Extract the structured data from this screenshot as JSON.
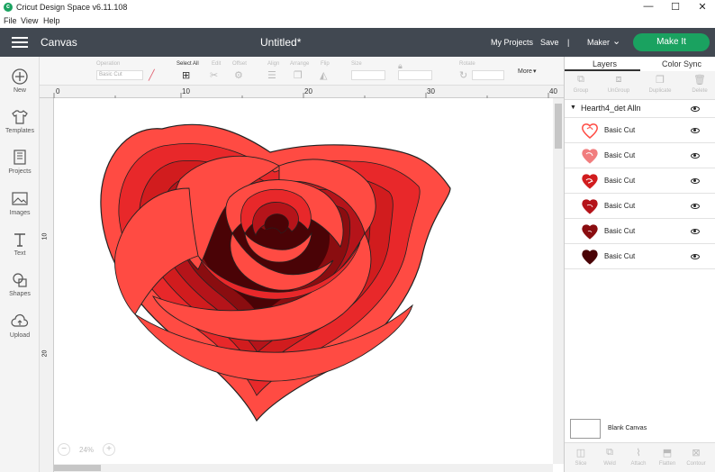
{
  "window": {
    "app_title": "Cricut Design Space  v6.11.108",
    "logo": "c",
    "controls": [
      "—",
      "☐",
      "✕"
    ]
  },
  "menu": [
    "File",
    "View",
    "Help"
  ],
  "header": {
    "section": "Canvas",
    "doc_title": "Untitled*",
    "my_projects": "My Projects",
    "save": "Save",
    "separator": "|",
    "machine": "Maker",
    "make_it": "Make It",
    "accent": "#1aa260",
    "bg": "#414851"
  },
  "sidebar": {
    "items": [
      {
        "label": "New",
        "icon": "plus-circle-icon"
      },
      {
        "label": "Templates",
        "icon": "shirt-icon"
      },
      {
        "label": "Projects",
        "icon": "projects-icon"
      },
      {
        "label": "Images",
        "icon": "image-icon"
      },
      {
        "label": "Text",
        "icon": "text-icon"
      },
      {
        "label": "Shapes",
        "icon": "shapes-icon"
      },
      {
        "label": "Upload",
        "icon": "cloud-upload-icon"
      }
    ]
  },
  "toolbar": {
    "operation_label": "Operation",
    "operation_value": "Basic Cut",
    "select_all": "Select All",
    "edit": "Edit",
    "offset": "Offset",
    "align": "Align",
    "arrange": "Arrange",
    "flip": "Flip",
    "size": "Size",
    "rotate": "Rotate",
    "more": "More"
  },
  "ruler": {
    "top": [
      "0",
      "10",
      "20",
      "30",
      "40"
    ],
    "left": [
      "10",
      "20"
    ]
  },
  "zoom": {
    "value": "24%",
    "minus": "−",
    "plus": "+"
  },
  "panel": {
    "tabs": [
      "Layers",
      "Color Sync"
    ],
    "actions": [
      "Group",
      "UnGroup",
      "Duplicate",
      "Delete"
    ],
    "group_name": "Hearth4_det Alln",
    "layers": [
      {
        "name": "Basic Cut",
        "color": "#ff4b43"
      },
      {
        "name": "Basic Cut",
        "color": "#e8282a"
      },
      {
        "name": "Basic Cut",
        "color": "#d11c1e"
      },
      {
        "name": "Basic Cut",
        "color": "#b5141a"
      },
      {
        "name": "Basic Cut",
        "color": "#8a0d10"
      },
      {
        "name": "Basic Cut",
        "color": "#4a0306"
      }
    ],
    "blank_canvas": "Blank Canvas",
    "bottom_actions": [
      "Slice",
      "Weld",
      "Attach",
      "Flatten",
      "Contour"
    ]
  },
  "design": {
    "colors": [
      "#ff4b43",
      "#e8282a",
      "#d11c1e",
      "#b5141a",
      "#8a0d10",
      "#4a0306"
    ]
  }
}
